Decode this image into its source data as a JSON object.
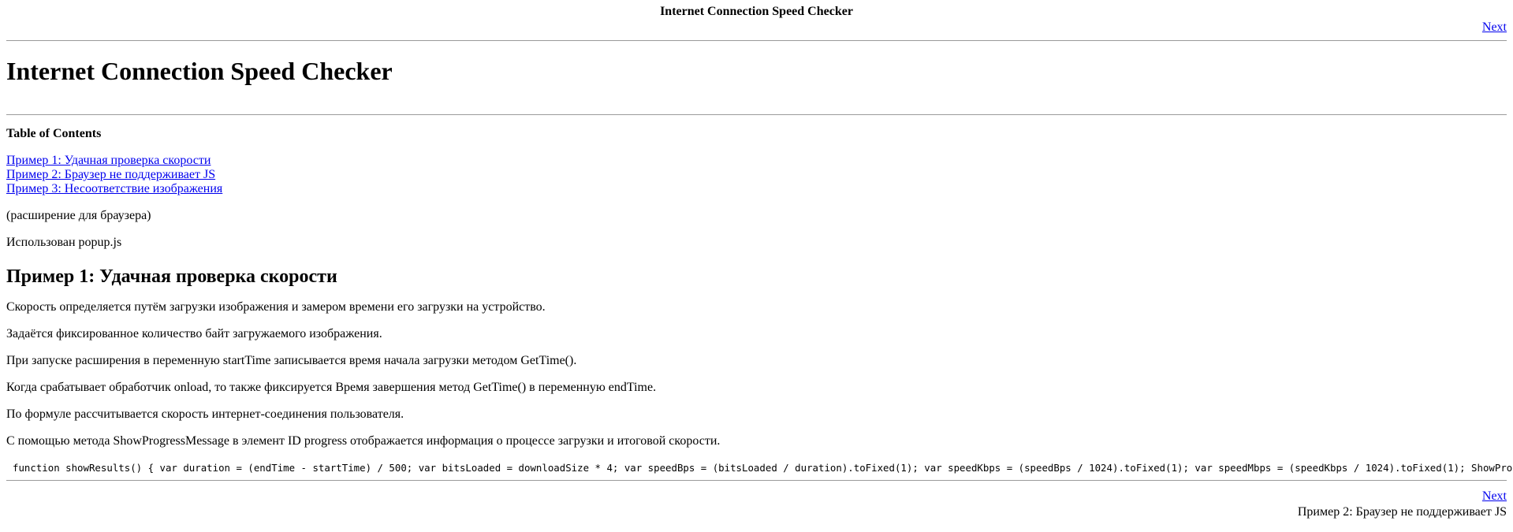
{
  "header": {
    "title": "Internet Connection Speed Checker",
    "next_link": "Next"
  },
  "main": {
    "heading": "Internet Connection Speed Checker",
    "toc": {
      "title": "Table of Contents",
      "items": [
        "Пример 1: Удачная проверка скорости",
        "Пример 2: Браузер не поддерживает JS",
        "Пример 3: Несоответствие изображения"
      ]
    },
    "intro_lines": [
      "(расширение для браузера)",
      "Использован popup.js"
    ],
    "section": {
      "heading": "Пример 1: Удачная проверка скорости",
      "paragraphs": [
        "Скорость определяется путём загрузки изображения и замером времени его загрузки на устройство.",
        "Задаётся фиксированное количество байт загружаемого изображения.",
        "При запуске расширения в переменную startTime записывается время начала загрузки методом GetTime().",
        "Когда срабатывает обработчик onload, то также фиксируется Время завершения метод GetTime() в переменную endTime.",
        "По формуле рассчитывается скорость интернет-соединения пользователя.",
        "С помощью метода ShowProgressMessage в элемент ID progress отображается информация о процессе загрузки и итоговой скорости."
      ],
      "code": "function showResults() { var duration = (endTime - startTime) / 500; var bitsLoaded = downloadSize * 4; var speedBps = (bitsLoaded / duration).toFixed(1); var speedKbps = (speedBps / 1024).toFixed(1); var speedMbps = (speedKbps / 1024).toFixed(1); ShowProgressMessage(["
    }
  },
  "footer": {
    "next_link": "Next",
    "next_caption": "Пример 2: Браузер не поддерживает JS"
  }
}
